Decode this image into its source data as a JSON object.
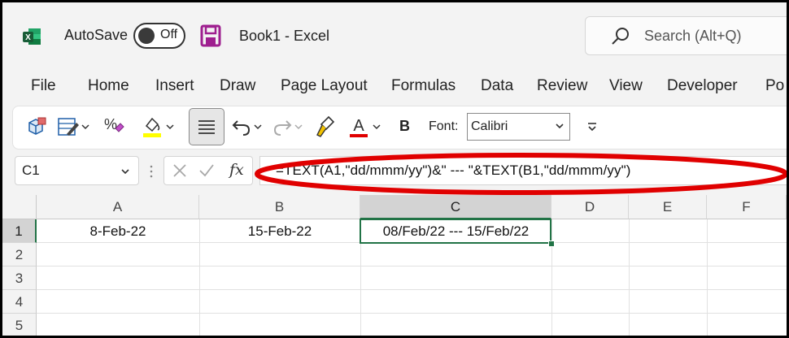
{
  "titlebar": {
    "autosave_label": "AutoSave",
    "autosave_state": "Off",
    "doc_title": "Book1  -  Excel",
    "search_placeholder": "Search (Alt+Q)"
  },
  "menu": [
    "File",
    "Home",
    "Insert",
    "Draw",
    "Page Layout",
    "Formulas",
    "Data",
    "Review",
    "View",
    "Developer",
    "Po"
  ],
  "toolbar": {
    "font_label": "Font:",
    "font_value": "Calibri",
    "bold_label": "B",
    "percent_label": "%",
    "font_color": "#e00000",
    "highlight_color": "#ffff00"
  },
  "formula_bar": {
    "name_box": "C1",
    "fx": "fx",
    "formula": "=TEXT(A1,\"dd/mmm/yy\")&\" --- \"&TEXT(B1,\"dd/mmm/yy\")",
    "annotation_color": "#e00000"
  },
  "grid": {
    "columns": [
      "A",
      "B",
      "C",
      "D",
      "E",
      "F"
    ],
    "rows": [
      "1",
      "2",
      "3",
      "4",
      "5"
    ],
    "cells": {
      "A1": "8-Feb-22",
      "B1": "15-Feb-22",
      "C1": "08/Feb/22 --- 15/Feb/22"
    },
    "accent": "#217346"
  }
}
